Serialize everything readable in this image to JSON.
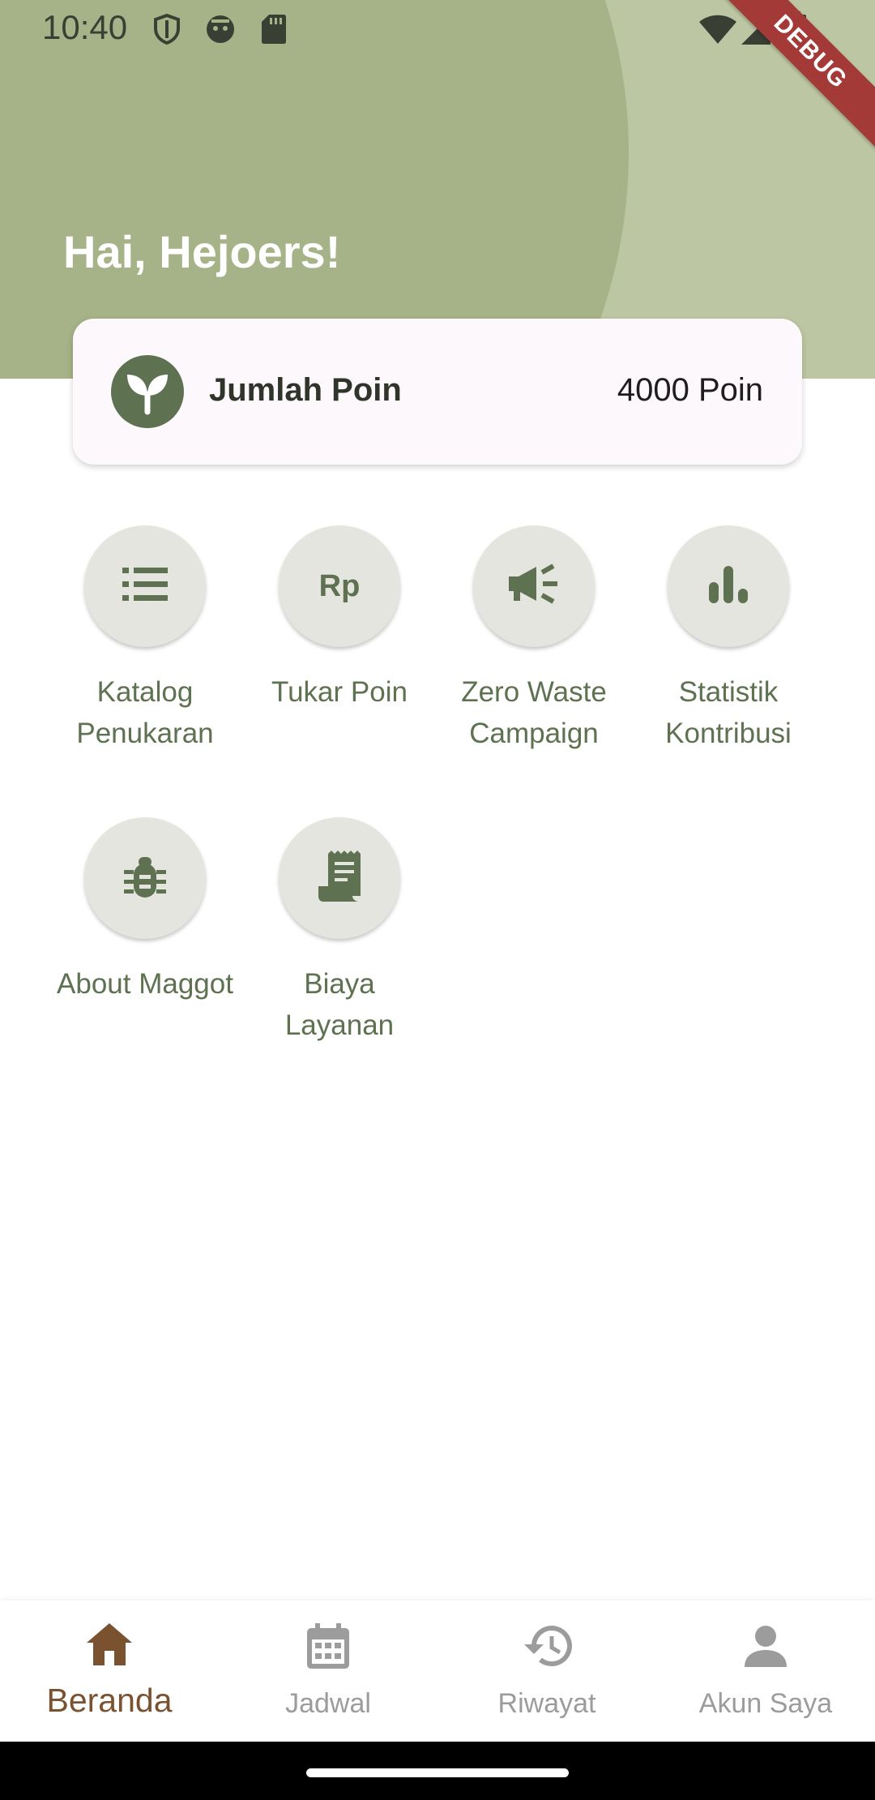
{
  "status_bar": {
    "time": "10:40",
    "icons": [
      "shield-icon",
      "android-icon",
      "sd-card-icon",
      "wifi-icon",
      "signal-icon",
      "battery-icon"
    ]
  },
  "debug_banner": "DEBUG",
  "header": {
    "greeting": "Hai, Hejoers!"
  },
  "points_card": {
    "icon": "sprout-icon",
    "label": "Jumlah Poin",
    "value": "4000 Poin"
  },
  "menu": [
    {
      "icon": "list-icon",
      "label_line1": "Katalog",
      "label_line2": "Penukaran"
    },
    {
      "icon": "rupiah-icon",
      "icon_text": "Rp",
      "label_line1": "Tukar Poin",
      "label_line2": ""
    },
    {
      "icon": "megaphone-icon",
      "label_line1": "Zero Waste",
      "label_line2": "Campaign"
    },
    {
      "icon": "bar-chart-icon",
      "label_line1": "Statistik",
      "label_line2": "Kontribusi"
    },
    {
      "icon": "bug-icon",
      "label_line1": "About Maggot",
      "label_line2": ""
    },
    {
      "icon": "receipt-icon",
      "label_line1": "Biaya",
      "label_line2": "Layanan"
    }
  ],
  "bottom_nav": [
    {
      "icon": "home-icon",
      "label": "Beranda",
      "active": true
    },
    {
      "icon": "calendar-icon",
      "label": "Jadwal",
      "active": false
    },
    {
      "icon": "history-icon",
      "label": "Riwayat",
      "active": false
    },
    {
      "icon": "person-icon",
      "label": "Akun Saya",
      "active": false
    }
  ],
  "colors": {
    "header_light": "#bdc6a3",
    "header_dark": "#a6b287",
    "accent_green": "#5e7150",
    "active_nav": "#7a5230",
    "inactive_nav": "#9c9c9c"
  }
}
